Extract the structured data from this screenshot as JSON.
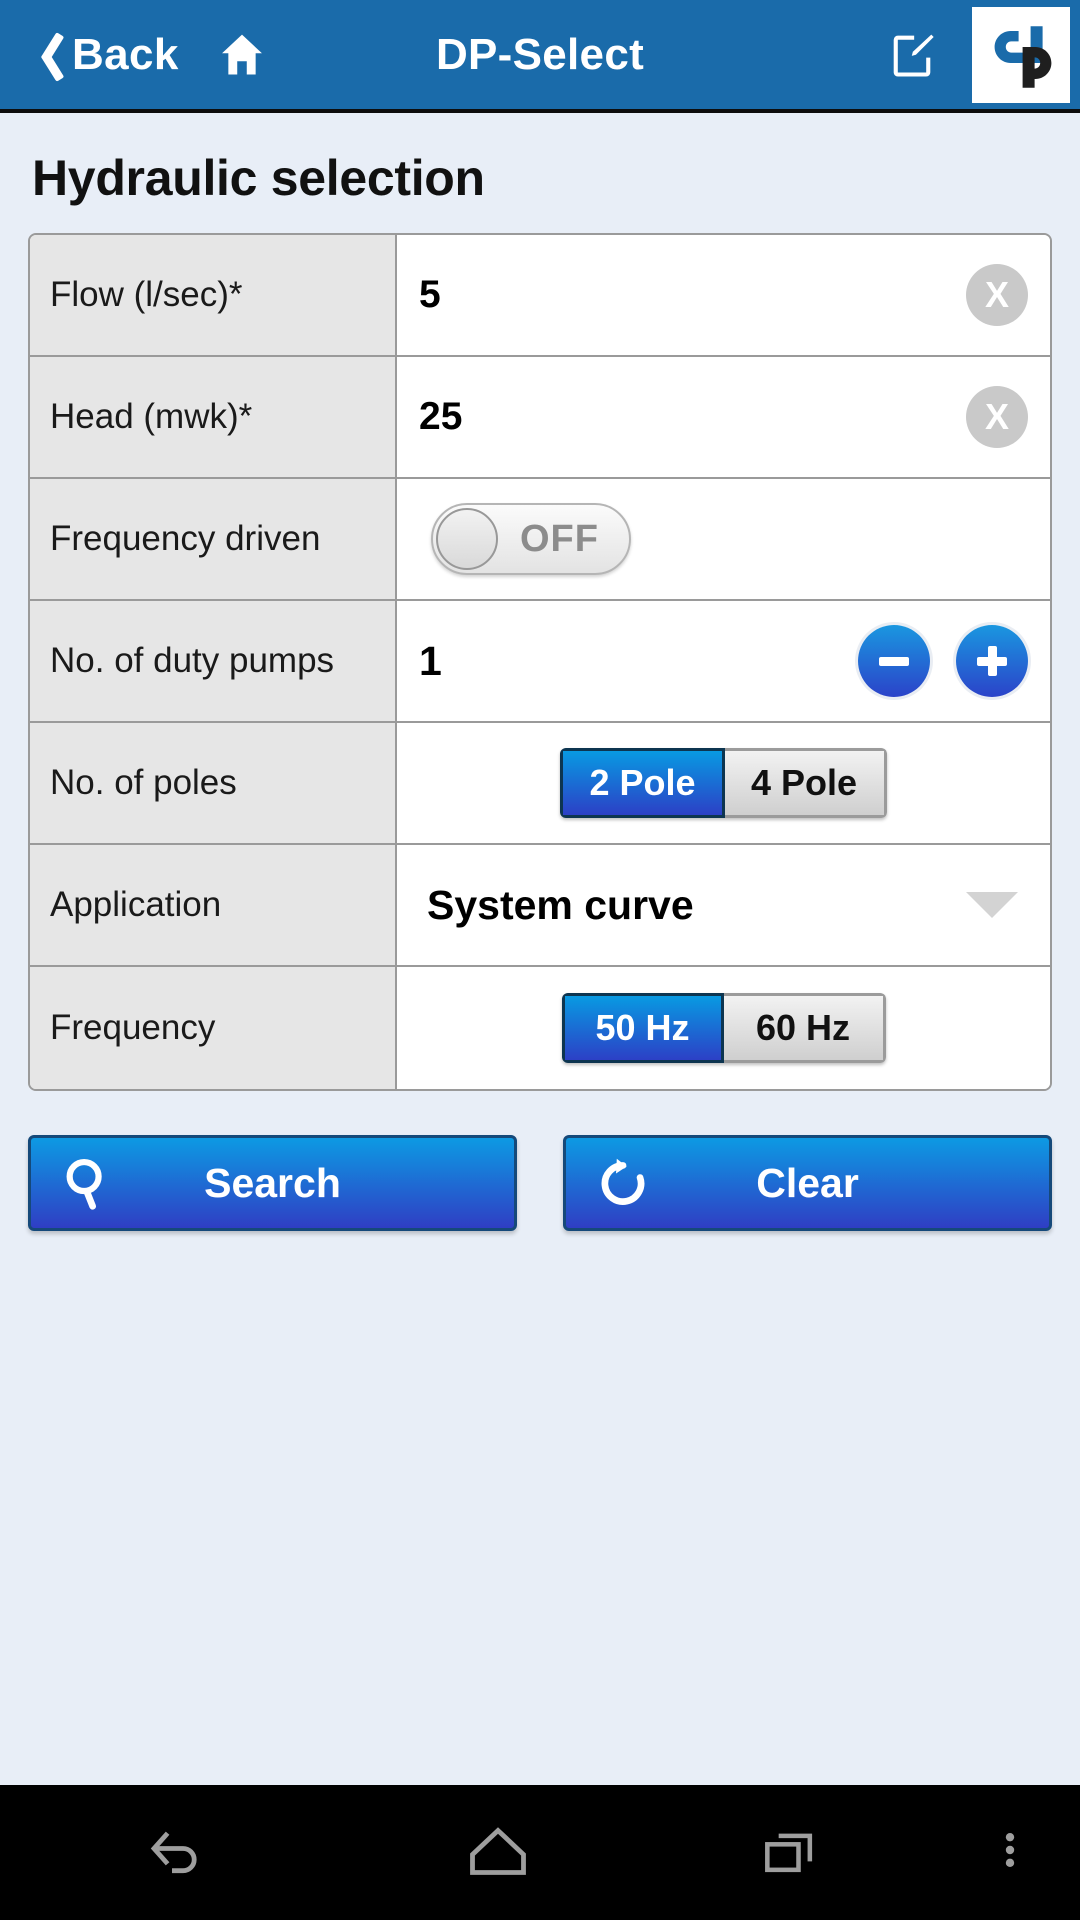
{
  "titlebar": {
    "back_label": "Back",
    "home_icon": "home-icon",
    "app_title": "DP-Select",
    "edit_icon": "edit-pencil-icon",
    "logo": "dp-logo"
  },
  "page": {
    "title": "Hydraulic selection"
  },
  "form": {
    "rows": [
      {
        "label": "Flow (l/sec)*",
        "type": "text",
        "value": "5",
        "clear": "X"
      },
      {
        "label": "Head (mwk)*",
        "type": "text",
        "value": "25",
        "clear": "X"
      },
      {
        "label": "Frequency driven",
        "type": "toggle",
        "value": "OFF",
        "state": "off"
      },
      {
        "label": "No. of duty pumps",
        "type": "stepper",
        "value": "1",
        "minus": "-",
        "plus": "+"
      },
      {
        "label": "No. of poles",
        "type": "segmented",
        "options": [
          "2 Pole",
          "4 Pole"
        ],
        "selected": "2 Pole"
      },
      {
        "label": "Application",
        "type": "dropdown",
        "value": "System curve"
      },
      {
        "label": "Frequency",
        "type": "segmented",
        "options": [
          "50 Hz",
          "60 Hz"
        ],
        "selected": "50 Hz"
      }
    ]
  },
  "actions": {
    "search_label": "Search",
    "search_icon": "magnifier-icon",
    "clear_label": "Clear",
    "clear_icon": "refresh-icon"
  },
  "navbar": {
    "back": "nav-back-icon",
    "home": "nav-home-icon",
    "recents": "nav-recents-icon",
    "menu": "nav-menu-icon"
  },
  "colors": {
    "titlebar": "#1a6baa",
    "accent_blue_top": "#0d9ae3",
    "accent_blue_bottom": "#2f3ec4",
    "page_bg": "#e8eef7",
    "row_label_bg": "#e6e6e6"
  }
}
